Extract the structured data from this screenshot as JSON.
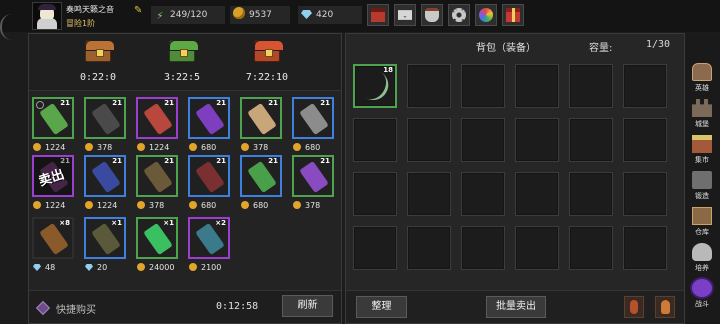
{
  "player": {
    "name": "奏鸣天籁之音",
    "rank": "冒险1阶",
    "avatar_icon": "player-avatar"
  },
  "resources": {
    "energy": "249/120",
    "gold": "9537",
    "gems": "420"
  },
  "top_icons": [
    "shop-icon",
    "mail-icon",
    "bag-icon",
    "settings-icon",
    "wheel-icon",
    "gift-icon"
  ],
  "chests": [
    {
      "icon": "wooden-chest-icon",
      "timer": "0:22:0"
    },
    {
      "icon": "green-chest-icon",
      "timer": "3:22:5"
    },
    {
      "icon": "red-chest-icon",
      "timer": "7:22:10"
    }
  ],
  "shop": {
    "rows": [
      [
        {
          "icon": "green-staff-icon",
          "rarity": "green",
          "count": "21",
          "price": "1224",
          "currency": "gold"
        },
        {
          "icon": "dark-tome-icon",
          "rarity": "green",
          "count": "21",
          "price": "378",
          "currency": "gold"
        },
        {
          "icon": "wand-icon",
          "rarity": "purple",
          "count": "21",
          "price": "1224",
          "currency": "gold"
        },
        {
          "icon": "purple-staff-icon",
          "rarity": "blue",
          "count": "21",
          "price": "680",
          "currency": "gold"
        },
        {
          "icon": "bone-sword-icon",
          "rarity": "green",
          "count": "21",
          "price": "378",
          "currency": "gold"
        },
        {
          "icon": "mace-icon",
          "rarity": "blue",
          "count": "21",
          "price": "680",
          "currency": "gold"
        }
      ],
      [
        {
          "icon": "robe-icon",
          "rarity": "purple",
          "count": "21",
          "price": "1224",
          "currency": "gold",
          "sold_text": "卖出"
        },
        {
          "icon": "blue-robe-icon",
          "rarity": "blue",
          "count": "21",
          "price": "1224",
          "currency": "gold"
        },
        {
          "icon": "boots-icon",
          "rarity": "green",
          "count": "21",
          "price": "378",
          "currency": "gold"
        },
        {
          "icon": "greaves-icon",
          "rarity": "blue",
          "count": "21",
          "price": "680",
          "currency": "gold"
        },
        {
          "icon": "green-boots-icon",
          "rarity": "blue",
          "count": "21",
          "price": "680",
          "currency": "gold"
        },
        {
          "icon": "purple-gauntlet-icon",
          "rarity": "green",
          "count": "21",
          "price": "378",
          "currency": "gold"
        }
      ],
      [
        {
          "icon": "spellbook-icon",
          "rarity": "plain",
          "count": "×8",
          "price": "48",
          "currency": "diamond"
        },
        {
          "icon": "rune-stone-icon",
          "rarity": "blue",
          "count": "×1",
          "price": "20",
          "currency": "diamond"
        },
        {
          "icon": "emerald-icon",
          "rarity": "green",
          "count": "×1",
          "price": "24000",
          "currency": "gold"
        },
        {
          "icon": "treasure-chest-icon",
          "rarity": "purple",
          "count": "×2",
          "price": "2100",
          "currency": "gold"
        }
      ]
    ],
    "quick_buy_label": "快捷购买",
    "refresh_timer": "0:12:58",
    "refresh_label": "刷新"
  },
  "bag": {
    "title": "背包（装备）",
    "capacity_label": "容量:",
    "capacity_value": "1/30",
    "first_item": {
      "icon": "bow-icon",
      "count": "18"
    },
    "sort_label": "整理",
    "bulk_sell_label": "批量卖出"
  },
  "nav": [
    {
      "id": "hero",
      "label": "英雄"
    },
    {
      "id": "castle",
      "label": "城堡"
    },
    {
      "id": "market",
      "label": "集市"
    },
    {
      "id": "forge",
      "label": "锻造"
    },
    {
      "id": "warehouse",
      "label": "仓库"
    },
    {
      "id": "cultivate",
      "label": "培养"
    },
    {
      "id": "battle",
      "label": "战斗"
    }
  ],
  "colors": {
    "green_rarity": "#4ea34e",
    "blue_rarity": "#3f7fe0",
    "purple_rarity": "#9c3fd0",
    "gold": "#e0a52a"
  }
}
